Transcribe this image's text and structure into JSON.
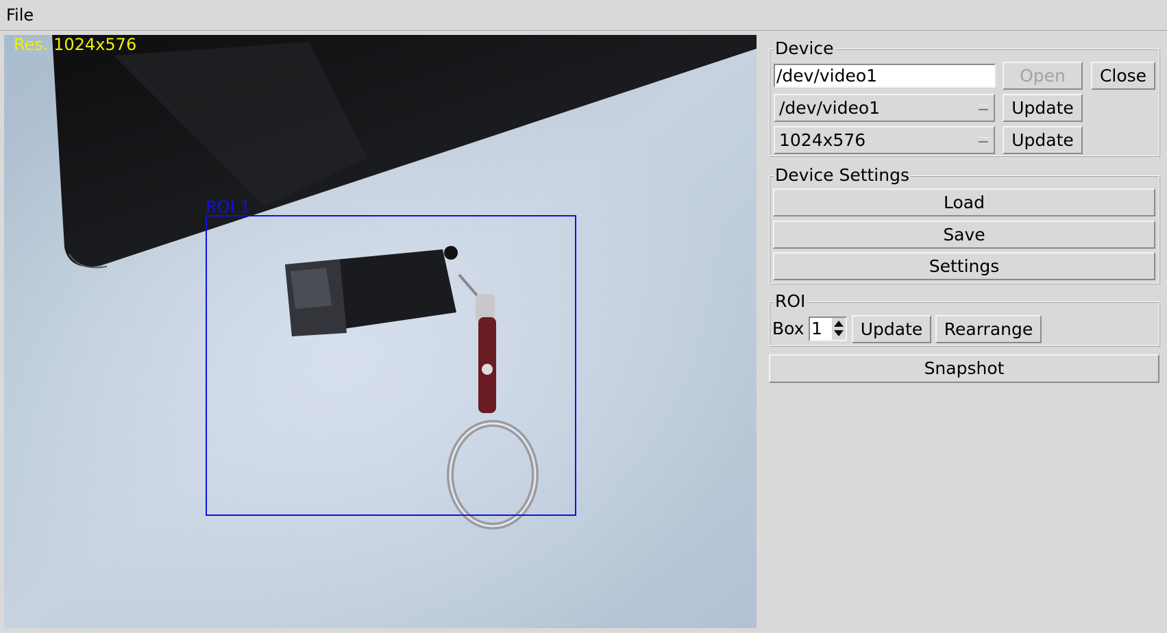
{
  "menubar": {
    "file_label": "File"
  },
  "video": {
    "resolution_label": "Res. 1024x576",
    "roi_label": "ROI 1",
    "roi_color": "#1010e0",
    "overlay_text_color": "#f0f000"
  },
  "device": {
    "title": "Device",
    "path_value": "/dev/video1",
    "open_label": "Open",
    "close_label": "Close",
    "device_select_value": "/dev/video1",
    "device_update_label": "Update",
    "resolution_select_value": "1024x576",
    "resolution_update_label": "Update"
  },
  "device_settings": {
    "title": "Device Settings",
    "load_label": "Load",
    "save_label": "Save",
    "settings_label": "Settings"
  },
  "roi": {
    "title": "ROI",
    "box_label": "Box",
    "box_value": "1",
    "update_label": "Update",
    "rearrange_label": "Rearrange"
  },
  "snapshot_label": "Snapshot"
}
